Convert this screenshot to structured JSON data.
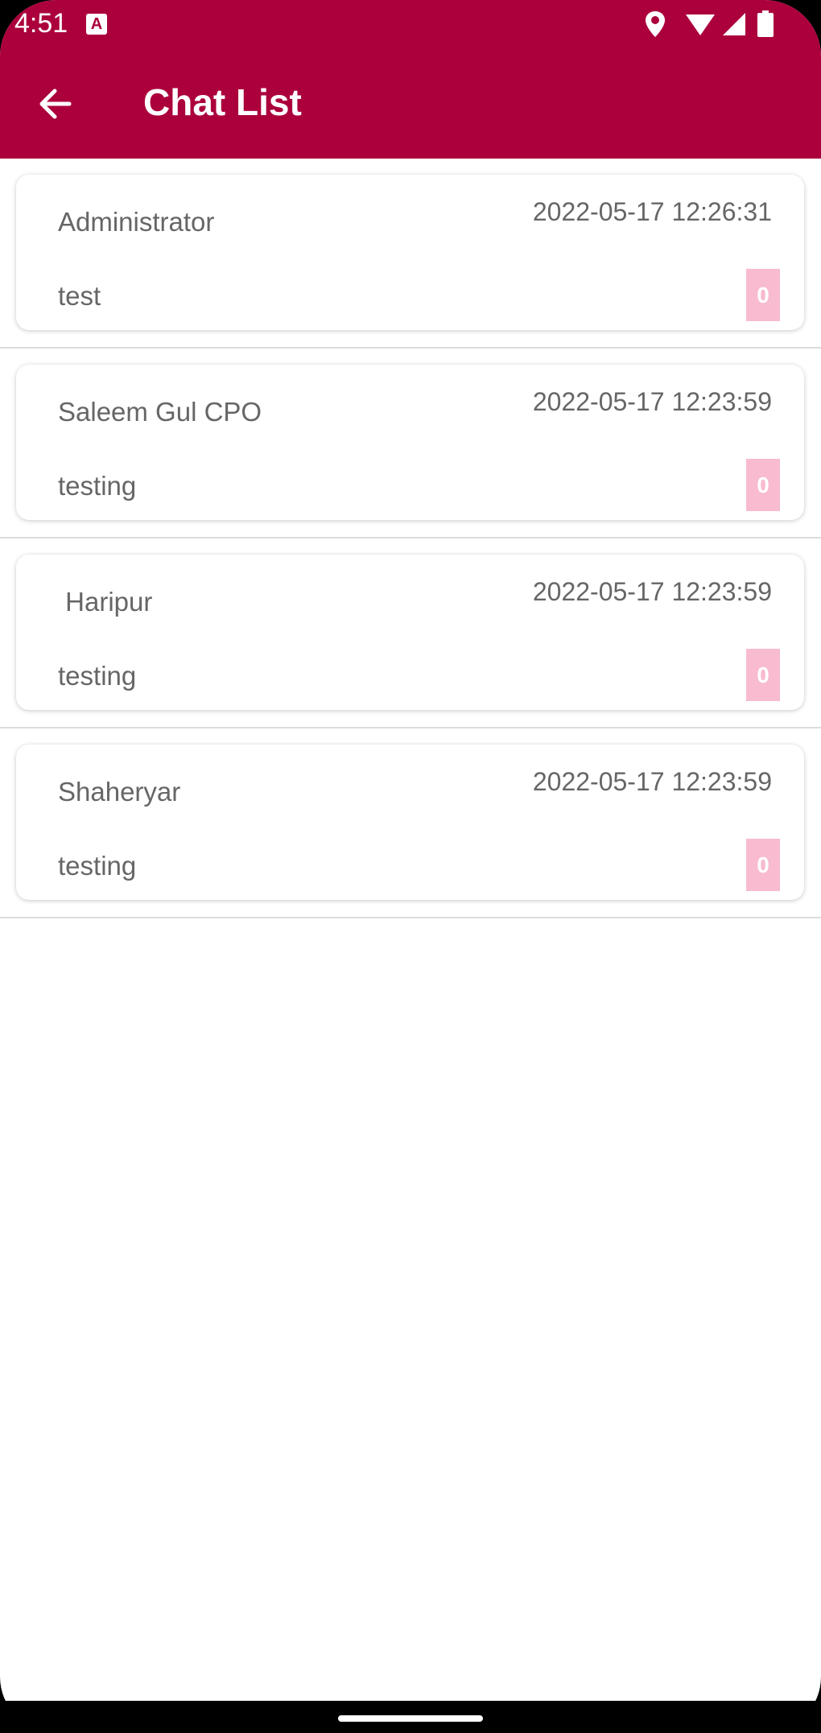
{
  "status_bar": {
    "time": "4:51",
    "notification_icon": "A"
  },
  "appbar": {
    "title": "Chat List",
    "color": "#ab003c"
  },
  "chats": [
    {
      "name": "Administrator",
      "timestamp": "2022-05-17 12:26:31",
      "last_message": "test",
      "unread": "0"
    },
    {
      "name": "Saleem Gul CPO",
      "timestamp": "2022-05-17 12:23:59",
      "last_message": "testing",
      "unread": "0"
    },
    {
      "name": " Haripur",
      "timestamp": "2022-05-17 12:23:59",
      "last_message": "testing",
      "unread": "0"
    },
    {
      "name": "Shaheryar",
      "timestamp": "2022-05-17 12:23:59",
      "last_message": "testing",
      "unread": "0"
    }
  ],
  "badge_color": "#f8bbd0"
}
